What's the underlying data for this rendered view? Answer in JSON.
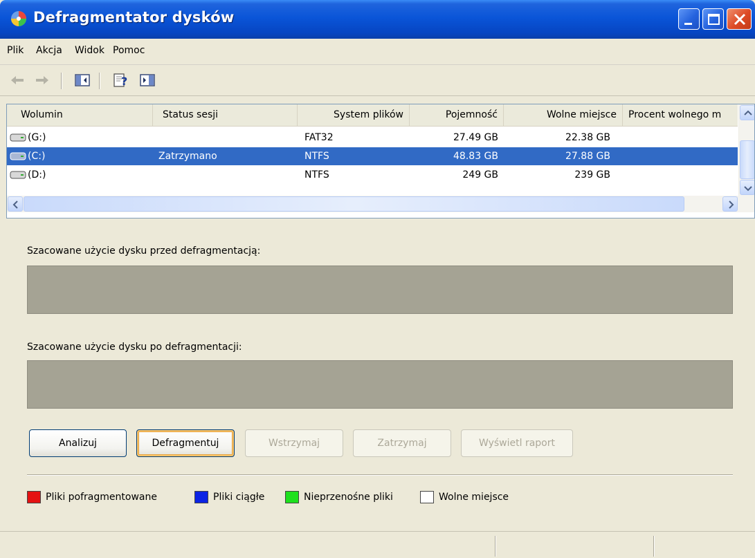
{
  "window": {
    "title": "Defragmentator dysków"
  },
  "menu": [
    "Plik",
    "Akcja",
    "Widok",
    "Pomoc"
  ],
  "toolbar": {
    "icons": [
      "back-arrow-icon",
      "forward-arrow-icon",
      "show-hide-console-tree-icon",
      "help-icon",
      "show-hide-action-pane-icon"
    ]
  },
  "volumes": {
    "columns": [
      "Wolumin",
      "Status sesji",
      "System plików",
      "Pojemność",
      "Wolne miejsce",
      "Procent wolnego m"
    ],
    "rows": [
      {
        "volume": "(G:)",
        "status": "",
        "fs": "FAT32",
        "capacity": "27.49 GB",
        "free": "22.38 GB",
        "percent": "",
        "selected": false
      },
      {
        "volume": "(C:)",
        "status": "Zatrzymano",
        "fs": "NTFS",
        "capacity": "48.83 GB",
        "free": "27.88 GB",
        "percent": "",
        "selected": true
      },
      {
        "volume": "(D:)",
        "status": "",
        "fs": "NTFS",
        "capacity": "249 GB",
        "free": "239 GB",
        "percent": "",
        "selected": false
      }
    ]
  },
  "panels": {
    "before_label": "Szacowane użycie dysku przed defragmentacją:",
    "after_label": "Szacowane użycie dysku po defragmentacji:"
  },
  "buttons": {
    "analyze": "Analizuj",
    "defragment": "Defragmentuj",
    "pause": "Wstrzymaj",
    "stop": "Zatrzymaj",
    "report": "Wyświetl raport"
  },
  "legend": [
    {
      "label": "Pliki pofragmentowane",
      "color": "#e41212"
    },
    {
      "label": "Pliki ciągłe",
      "color": "#0b23e4"
    },
    {
      "label": "Nieprzenośne pliki",
      "color": "#1ee01e"
    },
    {
      "label": "Wolne miejsce",
      "color": "#ffffff"
    }
  ],
  "colors": {
    "titlebar": "#0a55d8",
    "selection": "#316ac5",
    "usage_bar": "#a5a394"
  }
}
